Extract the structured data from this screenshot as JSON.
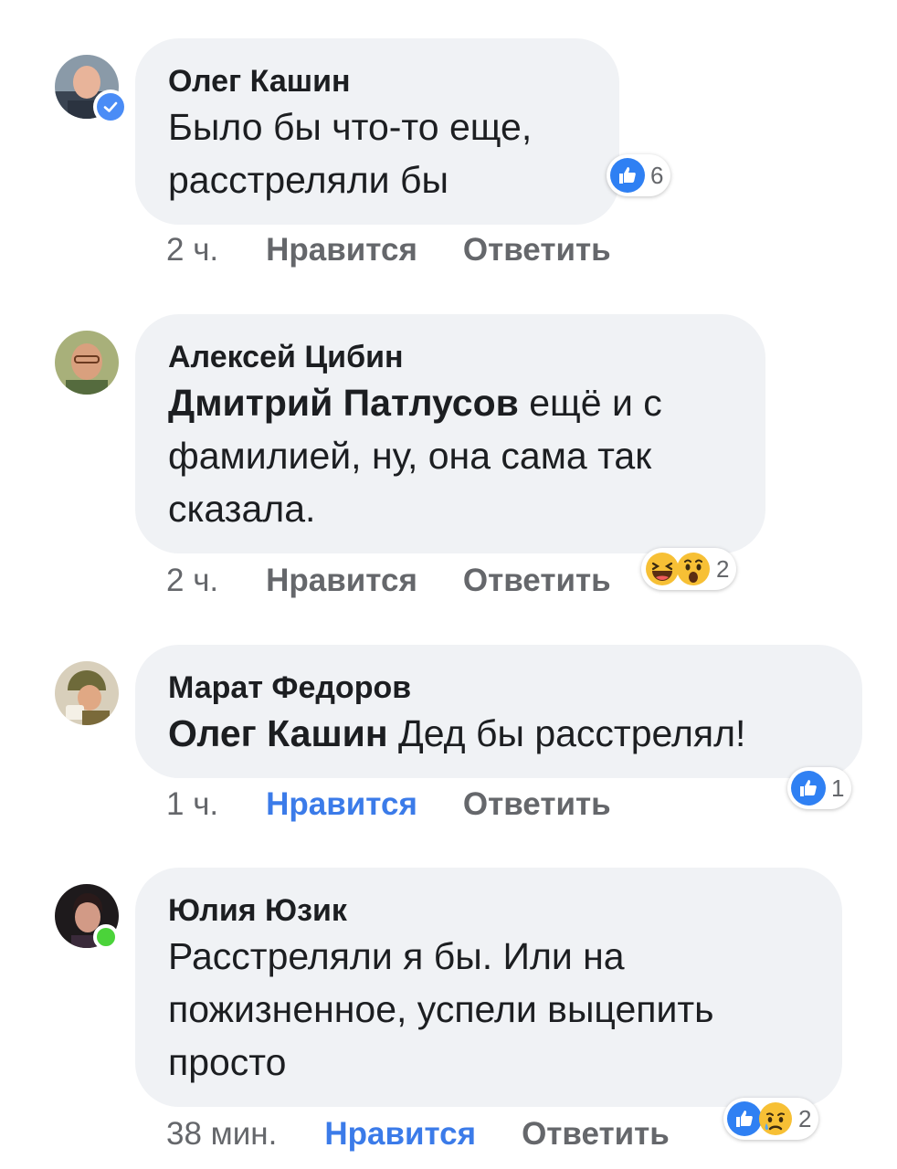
{
  "comments": [
    {
      "author": "Олег Кашин",
      "mention": "",
      "text_lines": [
        "Было бы что-то еще,",
        "расстреляли бы"
      ],
      "time": "2 ч.",
      "like_label": "Нравится",
      "reply_label": "Ответить",
      "liked": false,
      "reactions": [
        "like-icon"
      ],
      "reaction_count": "6",
      "verified": true,
      "online": false
    },
    {
      "author": "Алексей Цибин",
      "mention": "Дмитрий Патлусов",
      "text_first": " ещё и с",
      "text_lines": [
        "фамилией, ну, она сама так",
        "сказала."
      ],
      "time": "2 ч.",
      "like_label": "Нравится",
      "reply_label": "Ответить",
      "liked": false,
      "reactions": [
        "haha-icon",
        "wow-icon"
      ],
      "reaction_count": "2",
      "verified": false,
      "online": false
    },
    {
      "author": "Марат Федоров",
      "mention": "Олег Кашин",
      "text_first": " Дед бы расстрелял!",
      "text_lines": [],
      "time": "1 ч.",
      "like_label": "Нравится",
      "reply_label": "Ответить",
      "liked": true,
      "reactions": [
        "like-icon"
      ],
      "reaction_count": "1",
      "verified": false,
      "online": false
    },
    {
      "author": "Юлия Юзик",
      "mention": "",
      "text_lines": [
        "Расстреляли я бы. Или на",
        "пожизненное, успели выцепить",
        "просто"
      ],
      "time": "38 мин.",
      "like_label": "Нравится",
      "reply_label": "Ответить",
      "liked": true,
      "reactions": [
        "like-icon",
        "sad-icon"
      ],
      "reaction_count": "2",
      "verified": false,
      "online": true
    }
  ],
  "colors": {
    "bubble": "#f0f2f5",
    "like_active": "#3b7be9",
    "meta_text": "#65676b",
    "verified": "#4a8cf6",
    "online": "#4bd33a"
  }
}
